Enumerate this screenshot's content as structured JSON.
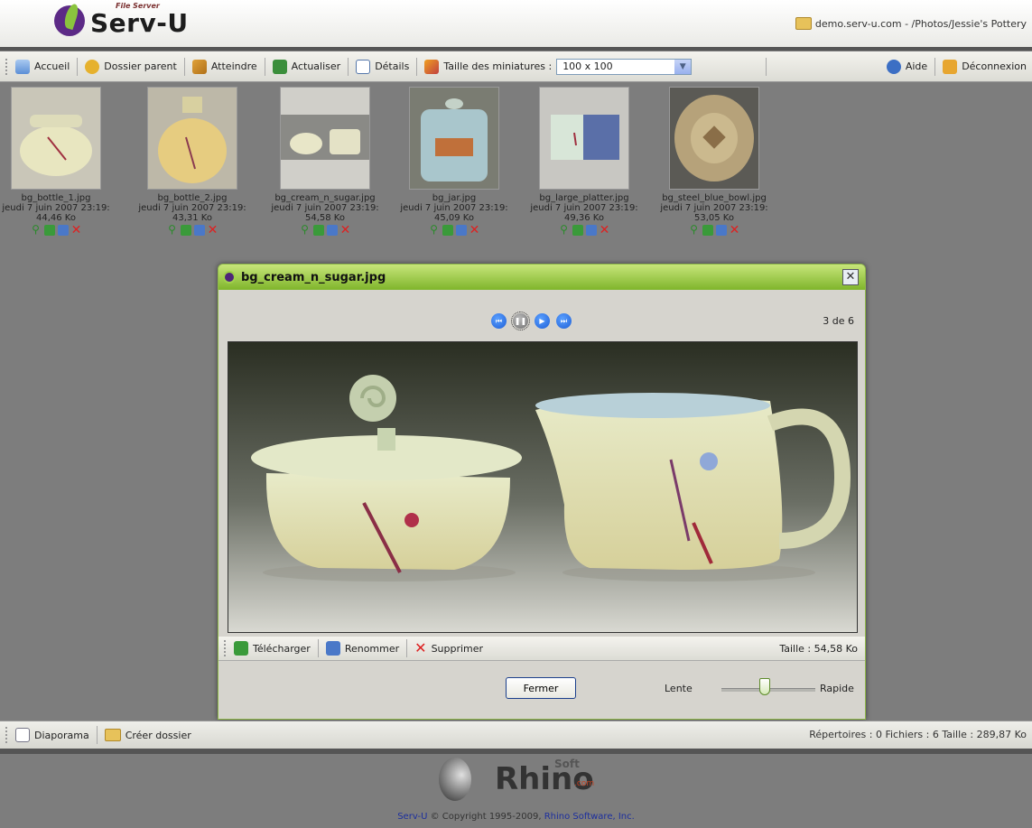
{
  "header": {
    "logo_text": "Serv-U",
    "logo_sup": "File Server",
    "path": "demo.serv-u.com - /Photos/Jessie's Pottery"
  },
  "toolbar": {
    "home": "Accueil",
    "parent": "Dossier parent",
    "goto": "Atteindre",
    "refresh": "Actualiser",
    "details": "Détails",
    "thumb_size_label": "Taille des miniatures :",
    "thumb_size_value": "100 x 100",
    "help": "Aide",
    "logout": "Déconnexion"
  },
  "files": [
    {
      "name": "bg_bottle_1.jpg",
      "date": "jeudi 7 juin 2007 23:19:",
      "size": "44,46 Ko"
    },
    {
      "name": "bg_bottle_2.jpg",
      "date": "jeudi 7 juin 2007 23:19:",
      "size": "43,31 Ko"
    },
    {
      "name": "bg_cream_n_sugar.jpg",
      "date": "jeudi 7 juin 2007 23:19:",
      "size": "54,58 Ko"
    },
    {
      "name": "bg_jar.jpg",
      "date": "jeudi 7 juin 2007 23:19:",
      "size": "45,09 Ko"
    },
    {
      "name": "bg_large_platter.jpg",
      "date": "jeudi 7 juin 2007 23:19:",
      "size": "49,36 Ko"
    },
    {
      "name": "bg_steel_blue_bowl.jpg",
      "date": "jeudi 7 juin 2007 23:19:",
      "size": "53,05 Ko"
    }
  ],
  "modal": {
    "title": "bg_cream_n_sugar.jpg",
    "counter": "3 de 6",
    "download": "Télécharger",
    "rename": "Renommer",
    "delete": "Supprimer",
    "size": "Taille : 54,58 Ko",
    "close": "Fermer",
    "slow": "Lente",
    "fast": "Rapide"
  },
  "bottombar": {
    "slideshow": "Diaporama",
    "new_folder": "Créer dossier",
    "stats": "Répertoires : 0   Fichiers : 6   Taille : 289,87 Ko"
  },
  "footer": {
    "brand": "Rhino",
    "brand_sup": "Soft",
    "brand_com": ".com",
    "product": "Serv-U",
    "copyright": "© Copyright 1995-2009,",
    "company": "Rhino Software, Inc."
  },
  "colors": {
    "title_green": "#7fb52b",
    "accent_blue": "#1f5fd6",
    "delete_red": "#d22"
  }
}
